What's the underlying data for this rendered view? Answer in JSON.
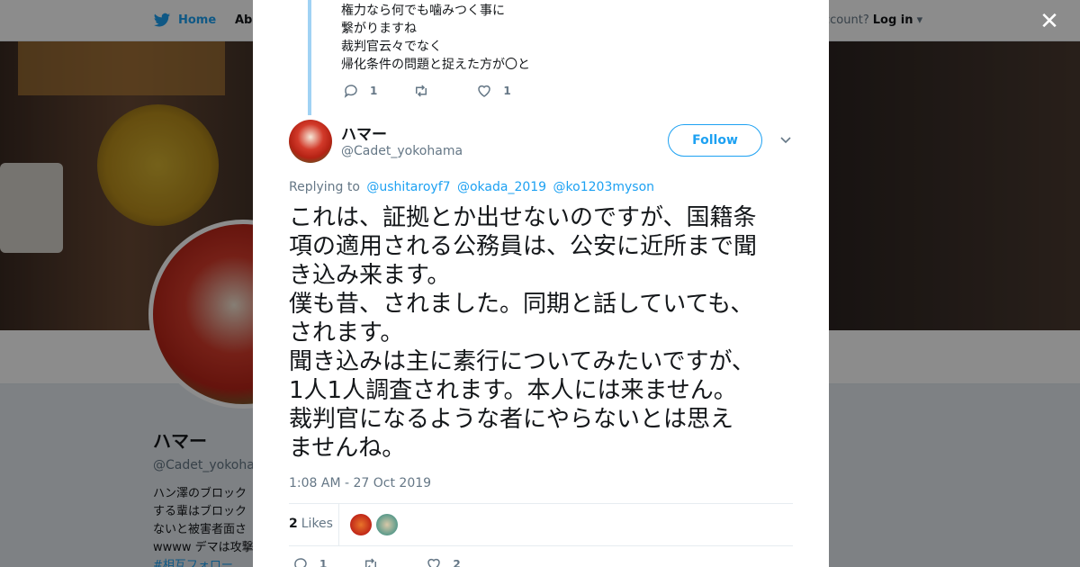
{
  "nav": {
    "home_label": "Home",
    "about_label": "Abo",
    "account_prompt": "ccount?",
    "login_label": "Log in"
  },
  "profile": {
    "name": "ハマー",
    "handle": "@Cadet_yokohan",
    "bio": "ハン澤のブロック\nする輩はブロック\nないと被害者面さ\nwwww デマは攻撃",
    "hashtag": "#相互フォロー"
  },
  "previous_tweet": {
    "lines": [
      "権力なら何でも噛みつく事に",
      "繋がりますね",
      "裁判官云々でなく",
      "帰化条件の問題と捉えた方が〇と"
    ],
    "reply_count": "1",
    "retweet_count": "",
    "like_count": "1"
  },
  "tweet": {
    "author_name": "ハマー",
    "author_handle": "@Cadet_yokohama",
    "follow_label": "Follow",
    "replying_prefix": "Replying to",
    "mentions": [
      "@ushitaroyf7",
      "@okada_2019",
      "@ko1203myson"
    ],
    "text_lines": [
      "これは、証拠とか出せないのですが、国籍条",
      "項の適用される公務員は、公安に近所まで聞",
      "き込み来ます。",
      "僕も昔、されました。同期と話していても、",
      "されます。",
      "聞き込みは主に素行についてみたいですが、",
      "1人1人調査されます。本人には来ません。",
      "裁判官になるような者にやらないとは思え",
      "ませんね。"
    ],
    "timestamp": "1:08 AM - 27 Oct 2019",
    "likes_count": "2",
    "likes_label": "Likes",
    "reply_count": "1",
    "retweet_count": "",
    "like_count": "2"
  },
  "colors": {
    "accent": "#1da1f2",
    "text": "#14171a",
    "muted": "#657786"
  },
  "icons": {
    "logo": "twitter-bird-icon",
    "close": "close-icon",
    "reply": "reply-icon",
    "retweet": "retweet-icon",
    "like": "heart-icon",
    "more": "chevron-down-icon"
  }
}
